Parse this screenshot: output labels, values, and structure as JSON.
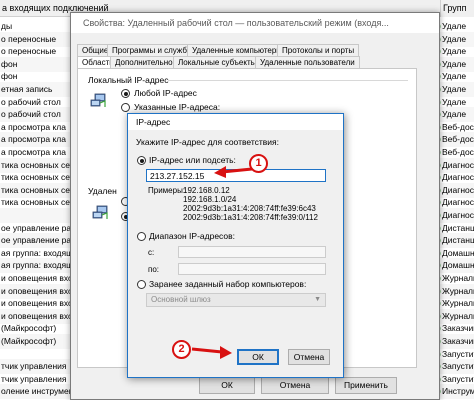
{
  "background": {
    "header_title": "а входящих подключений",
    "header_right": "Групп",
    "rows": [
      {
        "name": "ды",
        "group": "Удале"
      },
      {
        "name": "о переносные",
        "group": "Удале"
      },
      {
        "name": "о переносные",
        "group": "Удале"
      },
      {
        "name": "фон",
        "group": "Удале"
      },
      {
        "name": "фон",
        "group": "Удале"
      },
      {
        "name": "етная запись",
        "group": "Удале"
      },
      {
        "name": "о рабочий стол",
        "group": "Удале"
      },
      {
        "name": "о рабочий стол",
        "group": "Удале"
      },
      {
        "name": "а просмотра кла",
        "group": "Веб-дост"
      },
      {
        "name": "а просмотра кла",
        "group": "Веб-дост"
      },
      {
        "name": "а просмотра кла",
        "group": "Веб-дост"
      },
      {
        "name": "тика основных сетей",
        "group": "Диагности"
      },
      {
        "name": "тика основных сетей",
        "group": "Диагности"
      },
      {
        "name": "тика основных сетей",
        "group": "Диагности"
      },
      {
        "name": "тика основных сетей",
        "group": "Диагности"
      },
      {
        "name": "",
        "group": "Диагности"
      },
      {
        "name": "ое управление рабо",
        "group": "Дистанци"
      },
      {
        "name": "ое управление рабо",
        "group": "Дистанци"
      },
      {
        "name": "ая группа: входящ",
        "group": "Домашни"
      },
      {
        "name": "ая группа: входящ",
        "group": "Домашни"
      },
      {
        "name": "и оповещения входя",
        "group": "Журналы"
      },
      {
        "name": "и оповещения входя",
        "group": "Журналы"
      },
      {
        "name": "и оповещения входя",
        "group": "Журналы"
      },
      {
        "name": "и оповещения входя",
        "group": "Журналы"
      },
      {
        "name": "(Майкрософт)",
        "group": "Заказчик"
      },
      {
        "name": "(Майкрософт)",
        "group": "Заказчик"
      },
      {
        "name": "",
        "group": "Запустите"
      },
      {
        "name": "тчик управления",
        "group": "Запустите"
      },
      {
        "name": "тчик управления",
        "group": "Запустите"
      },
      {
        "name": "оление инструмента Windows (WMI) входящий трафик",
        "group": "Инструмен"
      }
    ]
  },
  "props_dialog": {
    "title": "Свойства: Удаленный рабочий стол — пользовательский режим (входя...",
    "tabs_row1": [
      "Общие",
      "Программы и службы",
      "Удаленные компьютеры",
      "Протоколы и порты"
    ],
    "tabs_row2": [
      "Область",
      "Дополнительно",
      "Локальные субъекты",
      "Удаленные пользователи"
    ],
    "local_group_label": "Локальный IP-адрес",
    "local_any": "Любой IP-адрес",
    "local_specified": "Указанные IP-адреса:",
    "remote_group_label": "Удален",
    "buttons": {
      "ok": "ОК",
      "cancel": "Отмена",
      "apply": "Применить"
    }
  },
  "ip_dialog": {
    "title": "IP-адрес",
    "prompt": "Укажите IP-адрес для соответствия:",
    "option_ip_or_subnet": "IP-адрес или подсеть:",
    "ip_value": "213.27.152.15",
    "examples_label": "Примеры:",
    "examples": [
      "192.168.0.12",
      "192.168.1.0/24",
      "2002:9d3b:1a31:4:208:74ff:fe39:6c43",
      "2002:9d3b:1a31:4:208:74ff:fe39:0/112"
    ],
    "option_range": "Диапазон IP-адресов:",
    "from_label": "с:",
    "to_label": "по:",
    "option_preset": "Заранее заданный набор компьютеров:",
    "preset_value": "Основной шлюз",
    "ok_label": "ОК",
    "cancel_label": "Отмена"
  },
  "callouts": {
    "step1": "1",
    "step2": "2"
  },
  "colors": {
    "accent": "#1f73c6",
    "callout": "#d81111"
  }
}
